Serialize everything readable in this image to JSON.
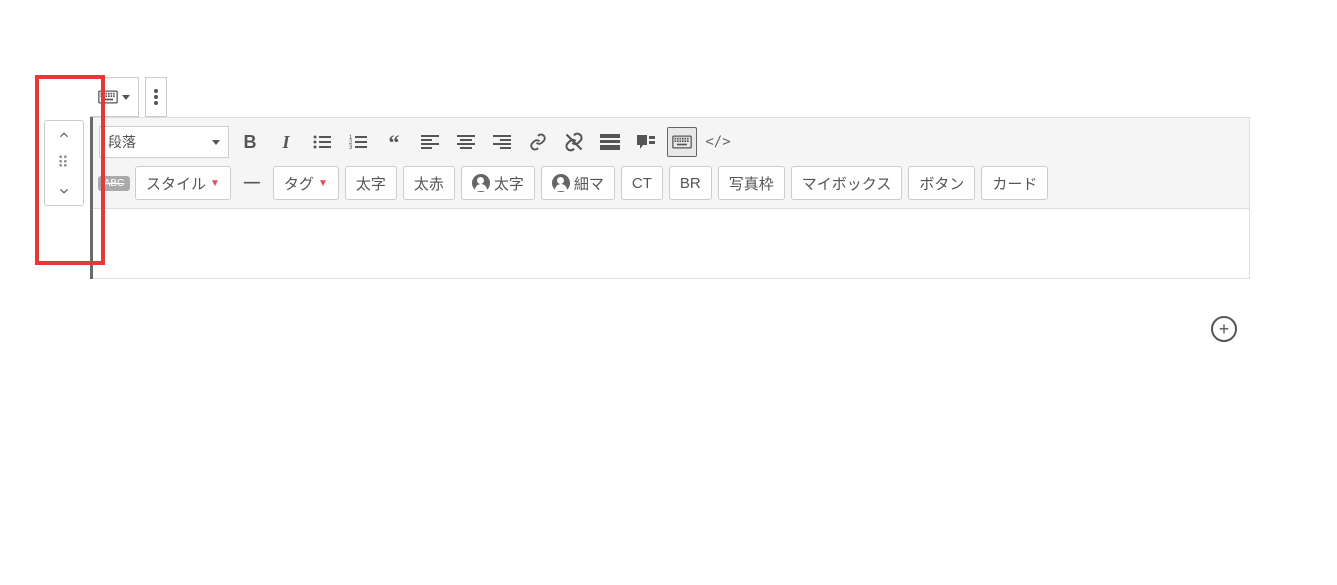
{
  "formatSelect": {
    "value": "段落"
  },
  "row2": {
    "style_label": "スタイル",
    "tag_label": "タグ",
    "bold_label": "太字",
    "boldred_label": "太赤",
    "user_bold_label": "太字",
    "user_thin_label": "細マ",
    "ct_label": "CT",
    "br_label": "BR",
    "photoframe_label": "写真枠",
    "mybox_label": "マイボックス",
    "button_label": "ボタン",
    "card_label": "カード",
    "strike_label": "ABC",
    "minus_label": "—"
  },
  "icons": {
    "code_label": "</>"
  }
}
